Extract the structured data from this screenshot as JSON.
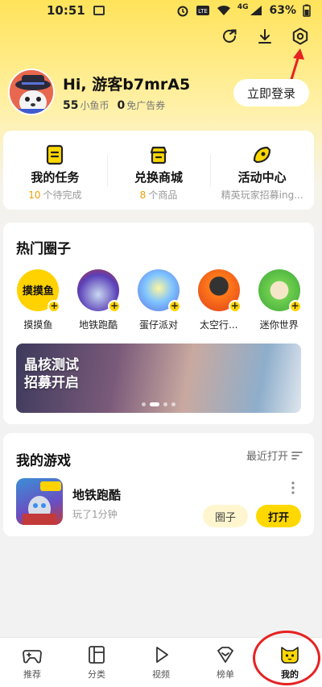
{
  "status_bar": {
    "time": "10:51",
    "network": "4G",
    "battery": "63%"
  },
  "profile": {
    "greeting": "Hi, 游客b7mrA5",
    "coins_value": "55",
    "coins_label": "小鱼币",
    "adfree_value": "0",
    "adfree_label": "免广告券",
    "login_label": "立即登录"
  },
  "tasks": [
    {
      "title": "我的任务",
      "num": "10",
      "sub": "个待完成",
      "icon": "task-list-icon"
    },
    {
      "title": "兑换商城",
      "num": "8",
      "sub": "个商品",
      "icon": "shop-icon"
    },
    {
      "title": "活动中心",
      "num": "",
      "sub": "精英玩家招募ing...",
      "icon": "activity-icon"
    }
  ],
  "circles": {
    "title": "热门圈子",
    "items": [
      {
        "label": "摸摸鱼",
        "thumb_text": "摸摸鱼",
        "color": "#ffd200"
      },
      {
        "label": "地铁跑酷",
        "color": "#5a3fb8"
      },
      {
        "label": "蛋仔派对",
        "color": "#5aa8ff"
      },
      {
        "label": "太空行...",
        "color": "#f05a1a"
      },
      {
        "label": "迷你世界",
        "color": "#6fcf4f"
      }
    ],
    "banner": {
      "line1": "晶核测试",
      "line2": "招募开启"
    }
  },
  "my_games": {
    "title": "我的游戏",
    "recent_label": "最近打开",
    "game": {
      "name": "地铁跑酷",
      "meta": "玩了1分钟",
      "circle_label": "圈子",
      "open_label": "打开"
    }
  },
  "bottom_nav": [
    {
      "label": "推荐",
      "icon": "game-controller-icon"
    },
    {
      "label": "分类",
      "icon": "category-icon"
    },
    {
      "label": "视频",
      "icon": "play-icon"
    },
    {
      "label": "榜单",
      "icon": "ranking-icon"
    },
    {
      "label": "我的",
      "icon": "cat-face-icon",
      "active": true
    }
  ],
  "colors": {
    "accent": "#ffd800",
    "annotation": "#e62222"
  }
}
